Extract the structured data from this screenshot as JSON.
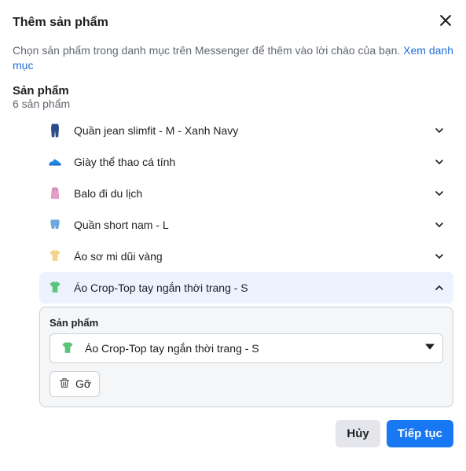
{
  "header": {
    "title": "Thêm sản phẩm"
  },
  "description": {
    "text": "Chọn sản phẩm trong danh mục trên Messenger để thêm vào lời chào của bạn. ",
    "link": "Xem danh mục"
  },
  "section": {
    "title": "Sản phẩm",
    "subtitle": "6 sản phẩm"
  },
  "products": [
    {
      "icon": "👖",
      "label": "Quần jean slimfit - M - Xanh Navy",
      "expanded": false
    },
    {
      "icon": "👟",
      "label": "Giày thể thao cá tính",
      "expanded": false
    },
    {
      "icon": "👜",
      "label": "Balo đi du lịch",
      "expanded": false
    },
    {
      "icon": "🩳",
      "label": "Quần short nam - L",
      "expanded": false
    },
    {
      "icon": "👕",
      "label": "Áo sơ mi dũi vàng",
      "expanded": false
    },
    {
      "icon": "👕",
      "label": "Áo Crop-Top tay ngắn thời trang - S",
      "expanded": true
    }
  ],
  "panel": {
    "label": "Sản phẩm",
    "selected_icon": "👕",
    "selected_label": "Áo Crop-Top tay ngắn thời trang - S",
    "remove": "Gỡ"
  },
  "footer": {
    "cancel": "Hủy",
    "continue": "Tiếp tục"
  },
  "icon_colors": {
    "jeans": "#2b4a8b",
    "shoe": "#1e88e5",
    "bag": "#e49cc8",
    "shorts": "#6fa8dc",
    "shirt_yellow": "#f3d38a",
    "shirt_green": "#5bc47a"
  }
}
